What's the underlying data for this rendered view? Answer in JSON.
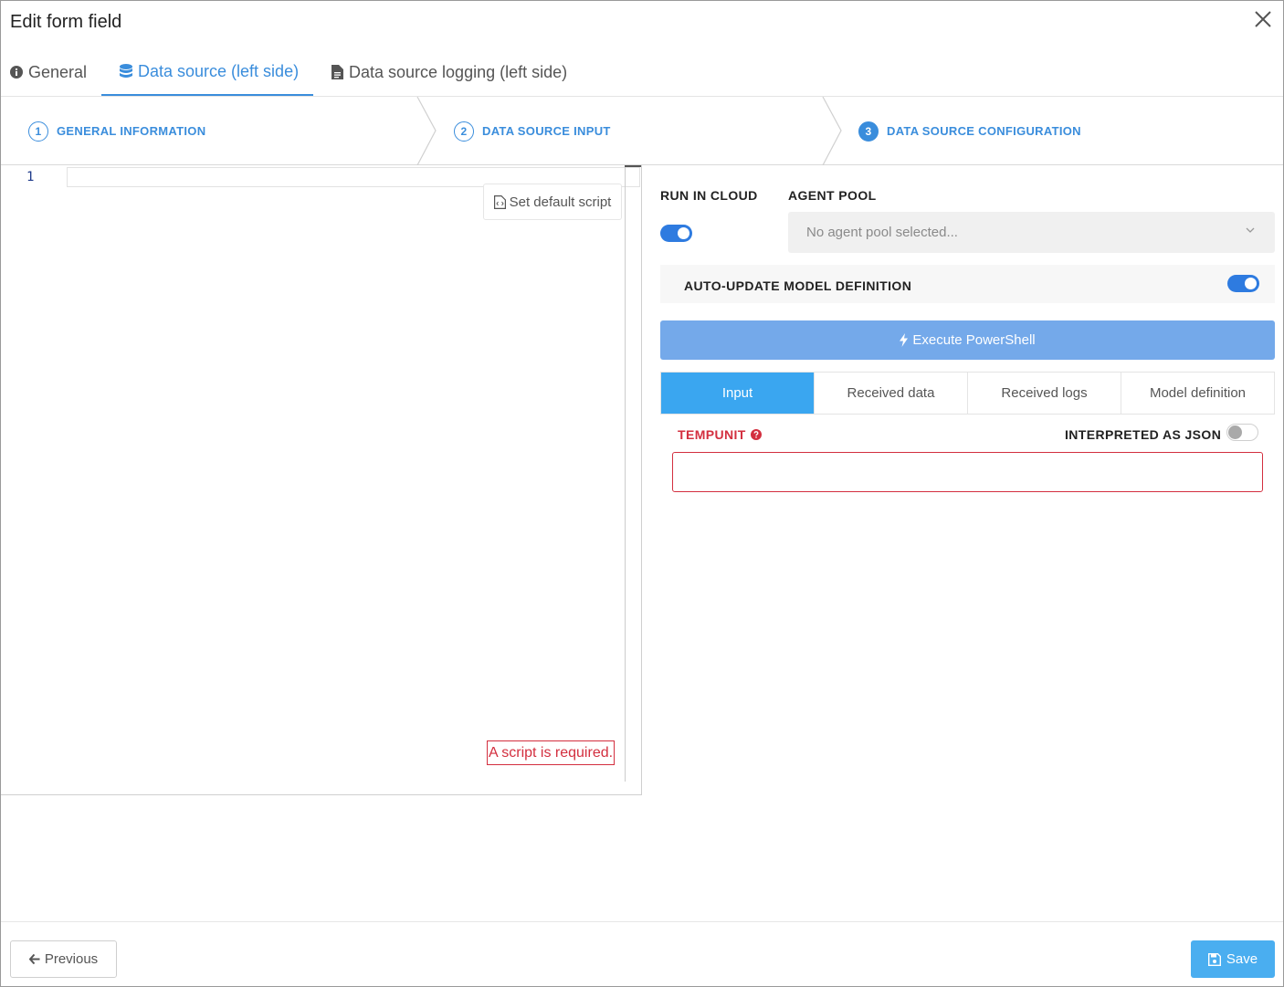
{
  "dialog": {
    "title": "Edit form field"
  },
  "tabs": [
    {
      "label": "General",
      "icon": "info-circle-icon"
    },
    {
      "label": "Data source (left side)",
      "icon": "database-icon",
      "active": true
    },
    {
      "label": "Data source logging (left side)",
      "icon": "file-text-icon"
    }
  ],
  "steps": [
    {
      "number": "1",
      "label": "GENERAL INFORMATION"
    },
    {
      "number": "2",
      "label": "DATA SOURCE INPUT"
    },
    {
      "number": "3",
      "label": "DATA SOURCE CONFIGURATION",
      "current": true
    }
  ],
  "editor": {
    "line_number": "1",
    "set_default_label": "Set default script",
    "error": "A script is required."
  },
  "config": {
    "run_in_cloud_label": "RUN IN CLOUD",
    "run_in_cloud": true,
    "agent_pool_label": "AGENT POOL",
    "agent_pool_placeholder": "No agent pool selected...",
    "auto_update_label": "AUTO-UPDATE MODEL DEFINITION",
    "auto_update": true,
    "execute_label": "Execute PowerShell"
  },
  "subtabs": [
    {
      "label": "Input",
      "active": true
    },
    {
      "label": "Received data"
    },
    {
      "label": "Received logs"
    },
    {
      "label": "Model definition"
    }
  ],
  "input_param": {
    "name": "TEMPUNIT",
    "json_label": "INTERPRETED AS JSON",
    "interpreted_as_json": false,
    "value": ""
  },
  "footer": {
    "previous_label": "Previous",
    "save_label": "Save"
  },
  "colors": {
    "accent": "#3a8ddc",
    "error": "#d32f3f",
    "toggle_on": "#2e7be0",
    "execute": "#74a9ea",
    "save": "#4aaef0"
  }
}
